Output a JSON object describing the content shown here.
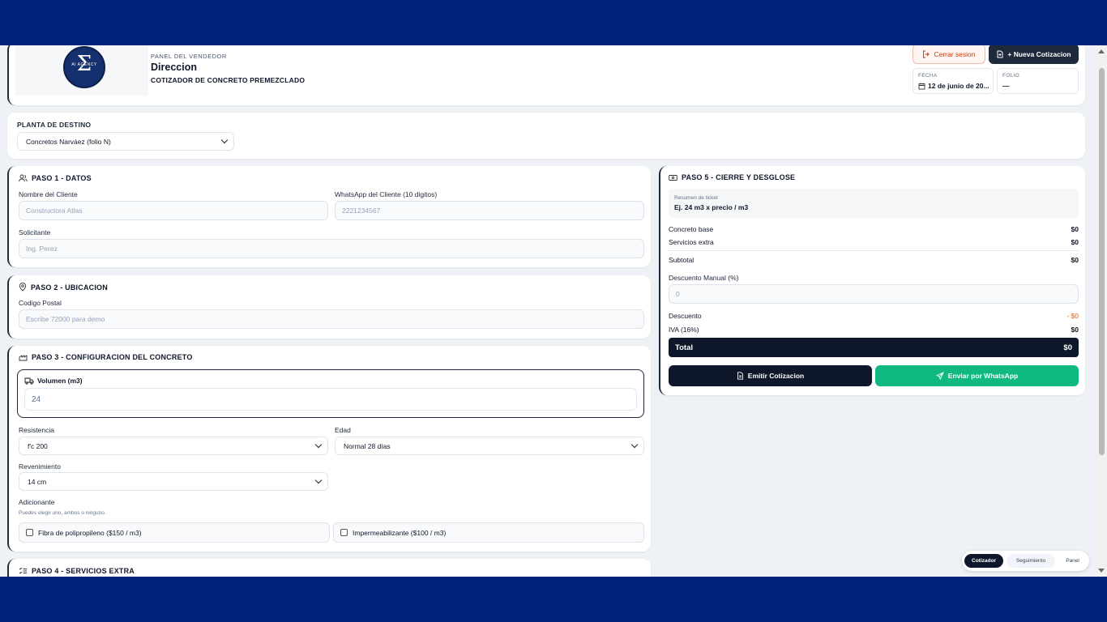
{
  "header": {
    "logo_text": "AI AGENCY",
    "eyebrow": "PANEL DEL VENDEDOR",
    "title": "Direccion",
    "subtitle": "COTIZADOR DE CONCRETO PREMEZCLADO",
    "logout_label": "Cerrar sesion",
    "new_quote_label": "+ Nueva Cotizacion",
    "fecha_label": "FECHA",
    "fecha_value": "12 de junio de 20...",
    "folio_label": "FOLIO",
    "folio_value": "—"
  },
  "planta": {
    "label": "PLANTA DE DESTINO",
    "selected": "Concretos Narváez (folio N)"
  },
  "paso1": {
    "title": "PASO 1 - DATOS",
    "cliente_label": "Nombre del Cliente",
    "cliente_placeholder": "Constructora Atlas",
    "whatsapp_label": "WhatsApp del Cliente (10 digitos)",
    "whatsapp_placeholder": "2221234567",
    "solicitante_label": "Solicitante",
    "solicitante_placeholder": "Ing. Perez"
  },
  "paso2": {
    "title": "PASO 2 - UBICACION",
    "cp_label": "Codigo Postal",
    "cp_placeholder": "Escribe 72000 para demo"
  },
  "paso3": {
    "title": "PASO 3 - CONFIGURACION DEL CONCRETO",
    "volumen_label": "Volumen (m3)",
    "volumen_value": "24",
    "resistencia_label": "Resistencia",
    "resistencia_value": "f'c 200",
    "edad_label": "Edad",
    "edad_value": "Normal 28 días",
    "revenimiento_label": "Revenimiento",
    "revenimiento_value": "14 cm",
    "adicionante_label": "Adicionante",
    "adicionante_hint": "Puedes elegir uno, ambos o ninguno.",
    "fibra_label": "Fibra de polipropileno ($150 / m3)",
    "imper_label": "Impermeabilizante ($100 / m3)"
  },
  "paso4": {
    "title": "PASO 4 - SERVICIOS EXTRA"
  },
  "paso5": {
    "title": "PASO 5 - CIERRE Y DESGLOSE",
    "ticket_label": "Resumen de ticket",
    "ticket_value": "Ej. 24 m3 x precio / m3",
    "concreto_base_label": "Concreto base",
    "concreto_base_value": "$0",
    "servicios_label": "Servicios extra",
    "servicios_value": "$0",
    "subtotal_label": "Subtotal",
    "subtotal_value": "$0",
    "descuento_manual_label": "Descuento Manual (%)",
    "descuento_manual_placeholder": "0",
    "descuento_label": "Descuento",
    "descuento_value": "- $0",
    "iva_label": "IVA (16%)",
    "iva_value": "$0",
    "total_label": "Total",
    "total_value": "$0",
    "emitir_label": "Emitir Cotizacion",
    "whatsapp_label": "Enviar por WhatsApp"
  },
  "bottom_nav": {
    "items": [
      "Cotizador",
      "Seguimiento",
      "Panel"
    ],
    "active": "Cotizador"
  },
  "colors": {
    "frame": "#012279",
    "dark": "#0f172a",
    "whatsapp": "#10b981",
    "logout": "#c2410c"
  }
}
